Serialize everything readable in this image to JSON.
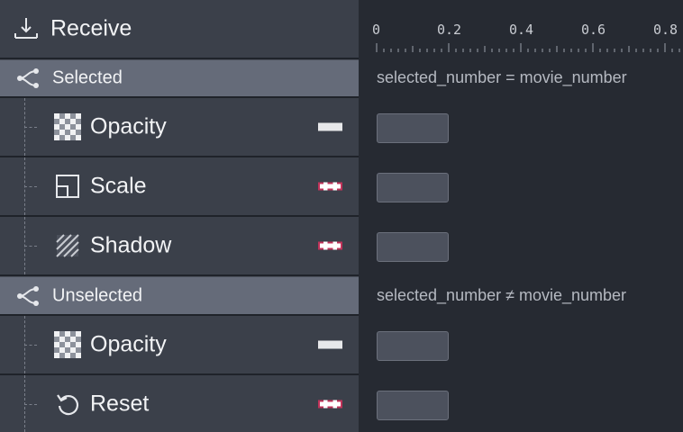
{
  "receive": {
    "label": "Receive",
    "icon": "download-icon"
  },
  "groups": [
    {
      "label": "Selected",
      "icon": "branch-icon",
      "condition": "selected_number = movie_number",
      "items": [
        {
          "label": "Opacity",
          "icon": "checkerboard-icon",
          "indicator": "solid",
          "value": ""
        },
        {
          "label": "Scale",
          "icon": "scale-icon",
          "indicator": "dashed",
          "value": ""
        },
        {
          "label": "Shadow",
          "icon": "shadow-icon",
          "indicator": "dashed",
          "value": ""
        }
      ]
    },
    {
      "label": "Unselected",
      "icon": "branch-icon",
      "condition": "selected_number ≠ movie_number",
      "items": [
        {
          "label": "Opacity",
          "icon": "checkerboard-icon",
          "indicator": "solid",
          "value": ""
        },
        {
          "label": "Reset",
          "icon": "reset-icon",
          "indicator": "dashed",
          "value": ""
        }
      ]
    }
  ],
  "ruler": {
    "ticks": [
      "0",
      "0.2",
      "0.4",
      "0.6",
      "0.8"
    ]
  },
  "colors": {
    "indicator_dashed": "#c0335a",
    "panel": "#3b404a",
    "group": "#656b79"
  }
}
